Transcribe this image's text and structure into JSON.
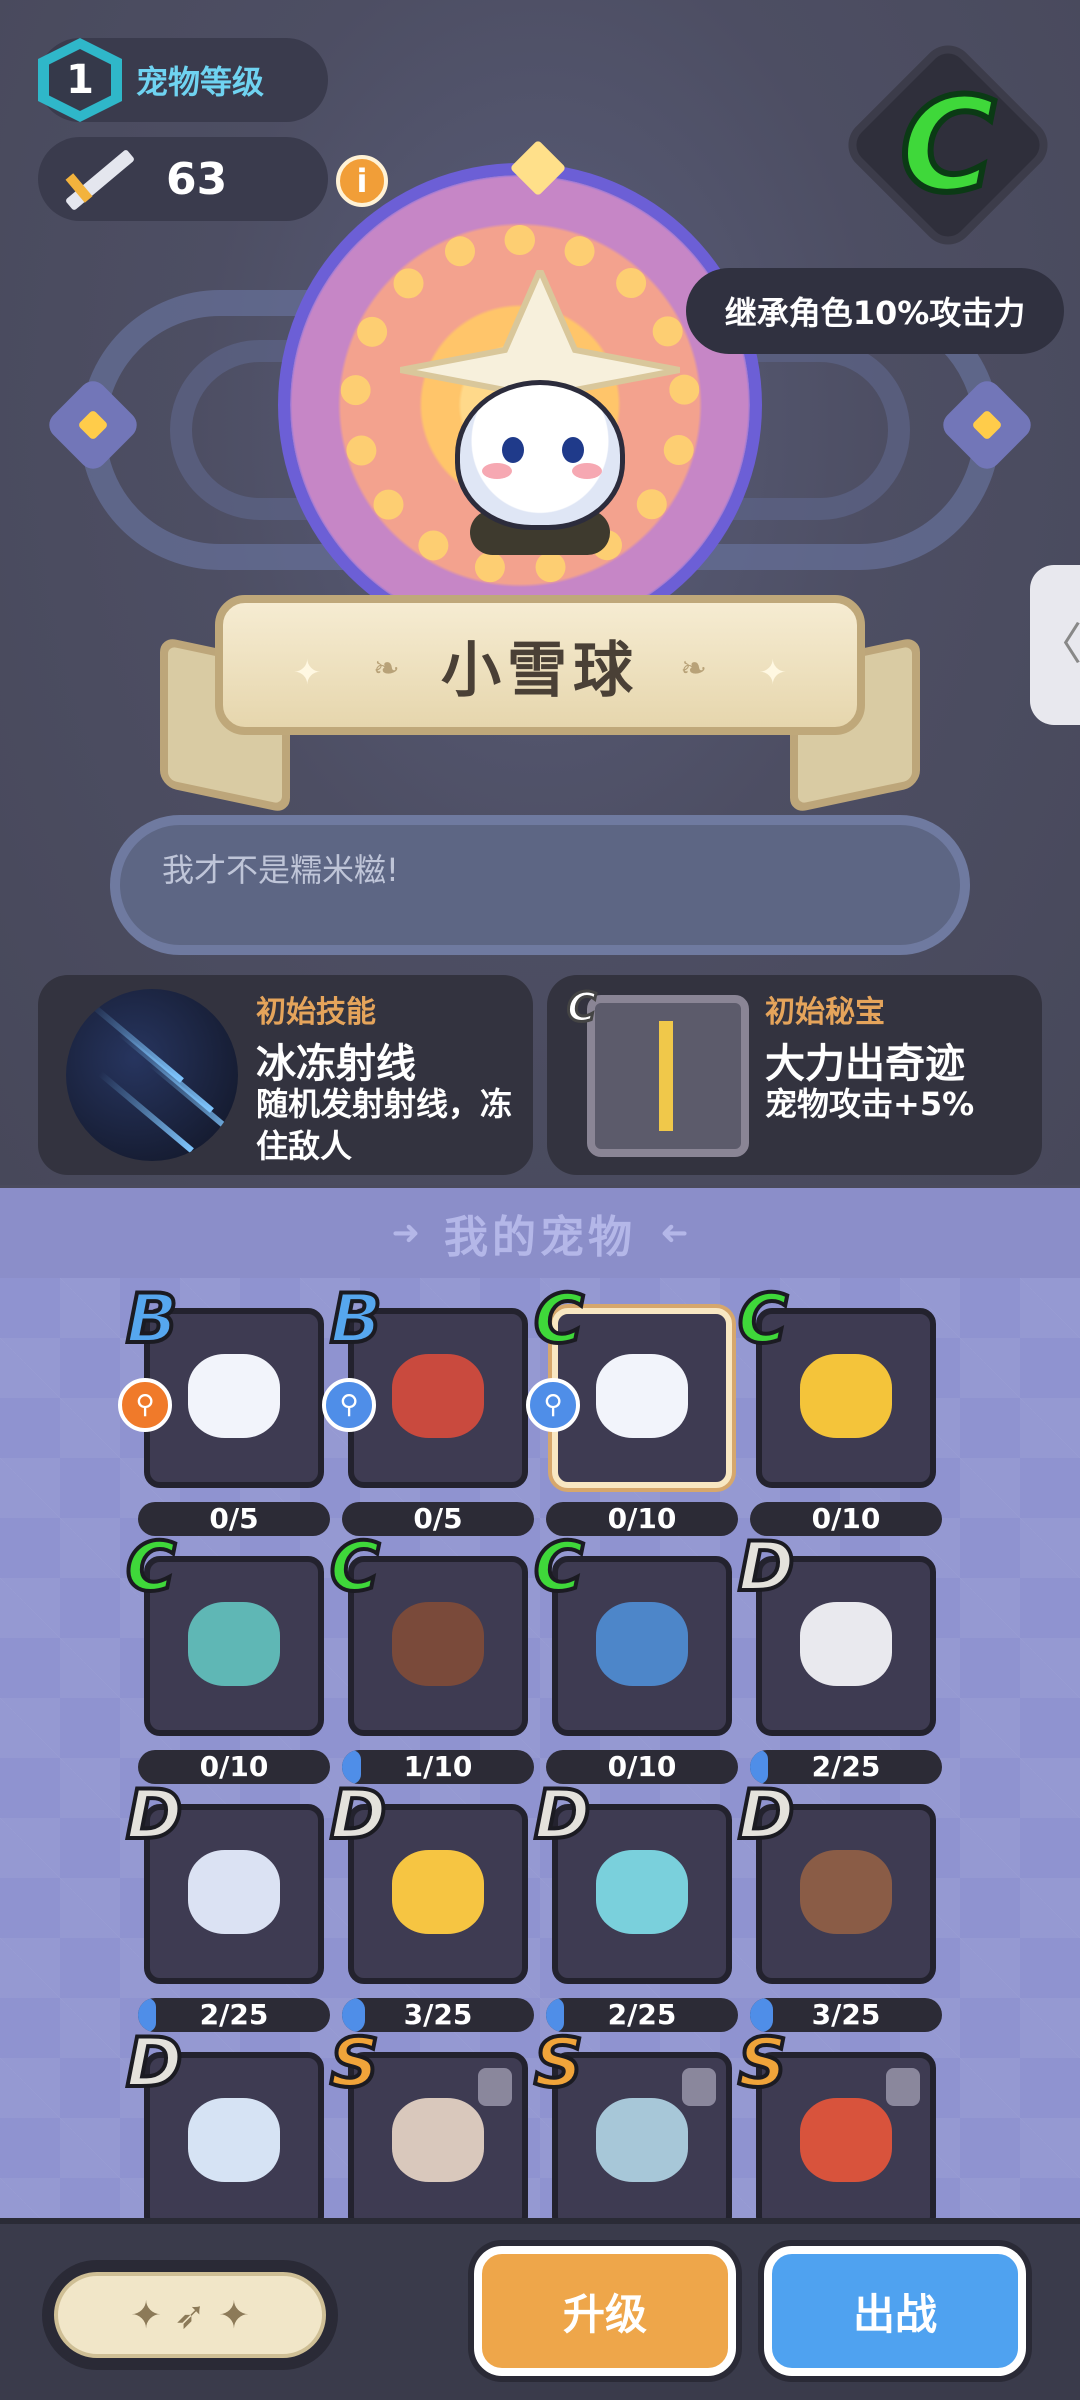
{
  "header": {
    "level": "1",
    "level_label": "宠物等级",
    "power": "63",
    "grade": "C",
    "inherit": "继承角色10%攻击力"
  },
  "pet": {
    "name": "小雪球",
    "quote": "我才不是糯米糍!"
  },
  "skill": {
    "label": "初始技能",
    "title": "冰冻射线",
    "desc": "随机发射射线，冻住敌人"
  },
  "treasure": {
    "grade": "C",
    "label": "初始秘宝",
    "title": "大力出奇迹",
    "desc": "宠物攻击+5%"
  },
  "pets_section": {
    "title": "我的宠物",
    "items": [
      {
        "grade": "B",
        "progress": "0/5",
        "fill": 0,
        "art_color": "#f2f4fb",
        "badge": "orange"
      },
      {
        "grade": "B",
        "progress": "0/5",
        "fill": 0,
        "art_color": "#c94a3e",
        "badge": "blue"
      },
      {
        "grade": "C",
        "progress": "0/10",
        "fill": 0,
        "art_color": "#f2f4fb",
        "badge": "blue",
        "selected": true
      },
      {
        "grade": "C",
        "progress": "0/10",
        "fill": 0,
        "art_color": "#f4c43a"
      },
      {
        "grade": "C",
        "progress": "0/10",
        "fill": 0,
        "art_color": "#5fb7b5"
      },
      {
        "grade": "C",
        "progress": "1/10",
        "fill": 0.1,
        "art_color": "#7a4a3a"
      },
      {
        "grade": "C",
        "progress": "0/10",
        "fill": 0,
        "art_color": "#4d86c9"
      },
      {
        "grade": "D",
        "progress": "2/25",
        "fill": 0.08,
        "art_color": "#e9e9ee"
      },
      {
        "grade": "D",
        "progress": "2/25",
        "fill": 0.08,
        "art_color": "#dbe2f3"
      },
      {
        "grade": "D",
        "progress": "3/25",
        "fill": 0.12,
        "art_color": "#f6c542"
      },
      {
        "grade": "D",
        "progress": "2/25",
        "fill": 0.08,
        "art_color": "#7ad0dc"
      },
      {
        "grade": "D",
        "progress": "3/25",
        "fill": 0.12,
        "art_color": "#8a5c46"
      },
      {
        "grade": "D",
        "progress": "",
        "fill": 0,
        "art_color": "#d6e3f4"
      },
      {
        "grade": "S",
        "progress": "",
        "fill": 0,
        "art_color": "#d9c8bc",
        "locked": true
      },
      {
        "grade": "S",
        "progress": "",
        "fill": 0,
        "art_color": "#a7c7d8",
        "locked": true
      },
      {
        "grade": "S",
        "progress": "",
        "fill": 0,
        "art_color": "#d8533c",
        "locked": true
      }
    ]
  },
  "footer": {
    "upgrade": "升级",
    "battle": "出战"
  },
  "icons": {
    "info": "i",
    "side_tab": "〈",
    "spark": "✦",
    "deco": "❧"
  }
}
